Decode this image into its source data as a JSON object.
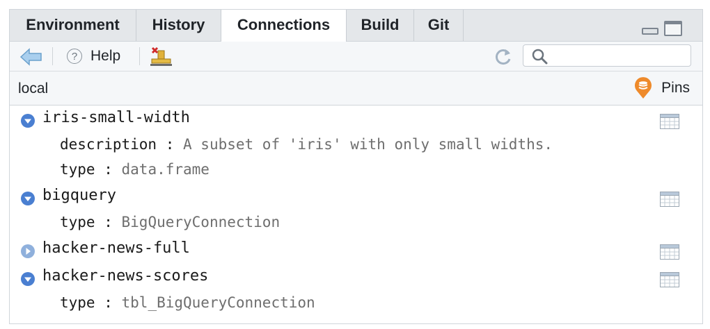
{
  "tabs": [
    {
      "label": "Environment",
      "active": false
    },
    {
      "label": "History",
      "active": false
    },
    {
      "label": "Connections",
      "active": true
    },
    {
      "label": "Build",
      "active": false
    },
    {
      "label": "Git",
      "active": false
    }
  ],
  "toolbar": {
    "help_label": "Help",
    "search_placeholder": ""
  },
  "header": {
    "connection_label": "local",
    "pins_label": "Pins"
  },
  "objects": [
    {
      "name": "iris-small-width",
      "expanded": true,
      "props": [
        {
          "key": "description",
          "sep": " : ",
          "value": "A subset of 'iris' with only small widths."
        },
        {
          "key": "type",
          "sep": " : ",
          "value": "data.frame"
        }
      ]
    },
    {
      "name": "bigquery",
      "expanded": true,
      "props": [
        {
          "key": "type",
          "sep": " : ",
          "value": "BigQueryConnection"
        }
      ]
    },
    {
      "name": "hacker-news-full",
      "expanded": false,
      "props": []
    },
    {
      "name": "hacker-news-scores",
      "expanded": true,
      "props": [
        {
          "key": "type",
          "sep": " : ",
          "value": "tbl_BigQueryConnection"
        }
      ]
    }
  ],
  "colors": {
    "expander_blue": "#4a7fd1",
    "pins_orange": "#ee8a2b",
    "value_gray": "#6e6e6e"
  }
}
